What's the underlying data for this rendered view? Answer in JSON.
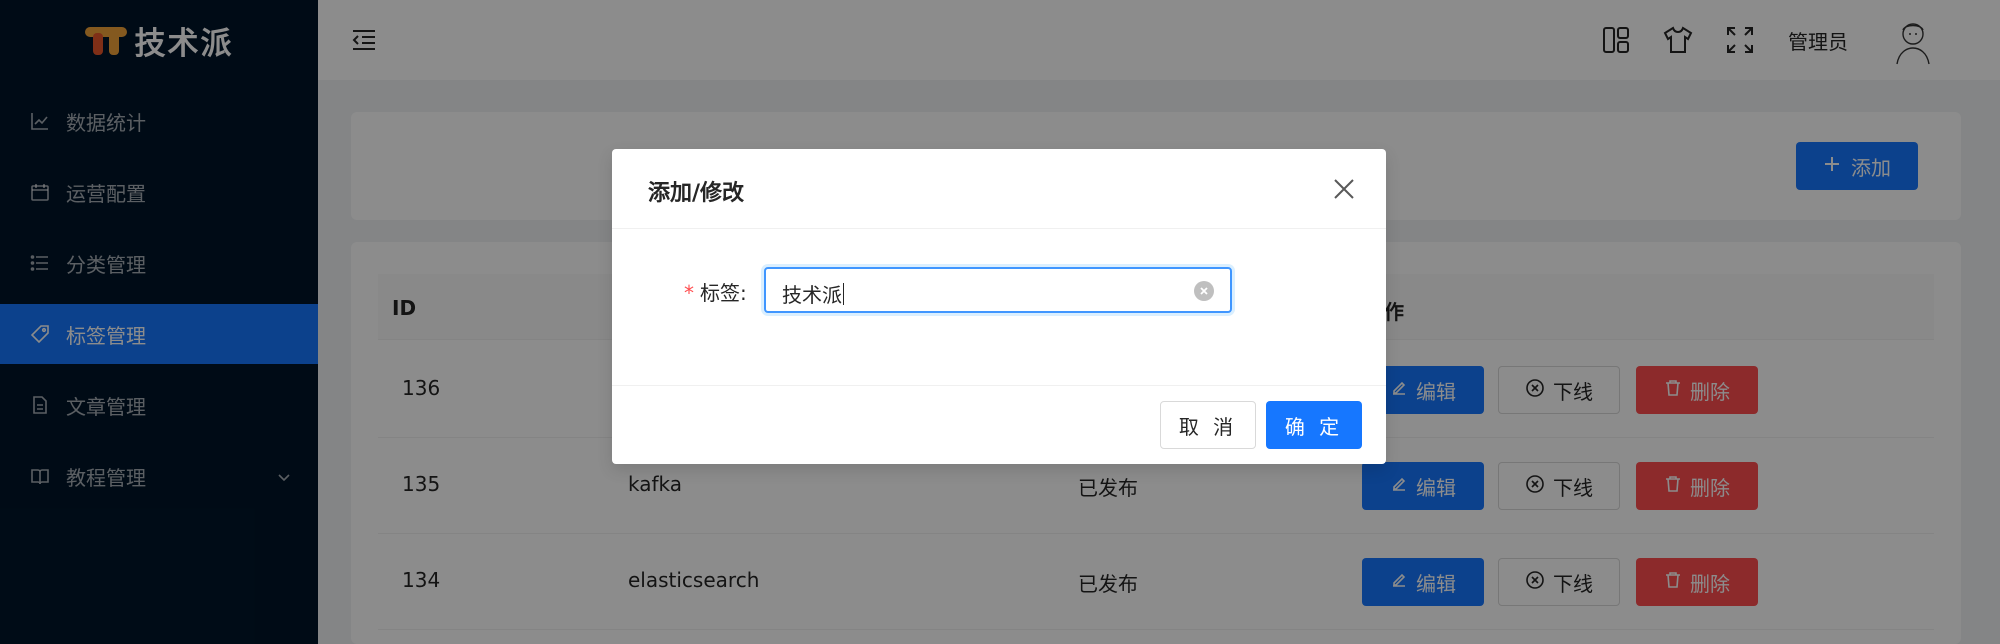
{
  "app": {
    "logo_text": "技术派",
    "user_name": "管理员"
  },
  "sidebar": {
    "items": [
      {
        "label": "数据统计",
        "icon": "line-chart-icon"
      },
      {
        "label": "运营配置",
        "icon": "calendar-icon"
      },
      {
        "label": "分类管理",
        "icon": "list-icon"
      },
      {
        "label": "标签管理",
        "icon": "tag-icon"
      },
      {
        "label": "文章管理",
        "icon": "file-icon"
      },
      {
        "label": "教程管理",
        "icon": "book-icon"
      }
    ]
  },
  "toolbar": {
    "add_label": "添加"
  },
  "table": {
    "headers": [
      "ID",
      "",
      "",
      "操作"
    ],
    "rows": [
      {
        "id": "136",
        "tag": "",
        "status": ""
      },
      {
        "id": "135",
        "tag": "kafka",
        "status": "已发布"
      },
      {
        "id": "134",
        "tag": "elasticsearch",
        "status": "已发布"
      }
    ],
    "actions": {
      "edit": "编辑",
      "offline": "下线",
      "delete": "删除"
    }
  },
  "modal": {
    "title": "添加/修改",
    "field_label": "标签:",
    "field_value": "技术派",
    "cancel_label": "取 消",
    "ok_label": "确 定"
  },
  "colors": {
    "primary": "#1677ff",
    "danger": "#ff4d4f",
    "sidebar_bg": "#001529"
  }
}
